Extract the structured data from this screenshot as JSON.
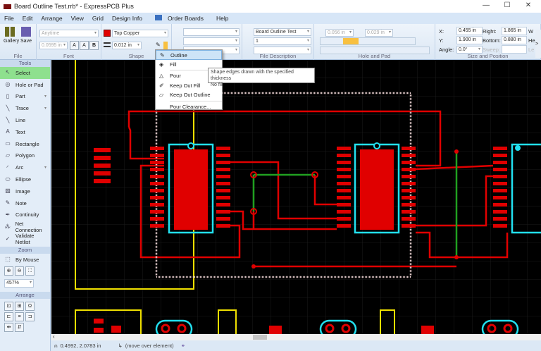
{
  "window": {
    "title": "Board Outline Test.rrb* - ExpressPCB Plus",
    "minimize": "—",
    "maximize": "☐",
    "close": "✕"
  },
  "menu": [
    "File",
    "Edit",
    "Arrange",
    "View",
    "Grid",
    "Design Info",
    "Order Boards",
    "Help"
  ],
  "ribbon": {
    "file": {
      "label": "File",
      "gallery": "Gallery",
      "save": "Save"
    },
    "font": {
      "label": "Font",
      "font_name": "Anytime",
      "font_size": "0.0595 in",
      "grow": "A",
      "shrink": "A",
      "bold": "B"
    },
    "shape": {
      "label": "Shape",
      "layer": "Top Copper",
      "layer_color": "#e00000",
      "thickness": "0.012 in"
    },
    "file_description": {
      "label": "File Description",
      "title": "Board Outline Test",
      "number": "1",
      "comment": ""
    },
    "hole_and_pad": {
      "label": "Hole and Pad",
      "pad_size": "0.056 in",
      "hole_size": "0.029 in"
    },
    "size_and_position": {
      "label": "Size and Position",
      "x_label": "X:",
      "x": "0.455 in",
      "y_label": "Y:",
      "y": "1.900 in",
      "angle_label": "Angle:",
      "angle": "0.0°",
      "right_label": "Right:",
      "right": "1.865 in",
      "bottom_label": "Bottom:",
      "bottom": "0.880 in",
      "sweep_label": "Sweep:",
      "w_label": "W",
      "h_label": "He",
      "l_label": "Le",
      "more": ">"
    }
  },
  "sidebar": {
    "tools_label": "Tools",
    "tools": [
      {
        "label": "Select",
        "icon": "↖",
        "selected": true
      },
      {
        "label": "Hole or Pad",
        "icon": "◎"
      },
      {
        "label": "Part",
        "icon": "▯",
        "arrow": "▾"
      },
      {
        "label": "Trace",
        "icon": "╲",
        "arrow": "▾"
      },
      {
        "label": "Line",
        "icon": "╲"
      },
      {
        "label": "Text",
        "icon": "A"
      },
      {
        "label": "Rectangle",
        "icon": "▭"
      },
      {
        "label": "Polygon",
        "icon": "▱"
      },
      {
        "label": "Arc",
        "icon": "◜",
        "arrow": "▾"
      },
      {
        "label": "Ellipse",
        "icon": "⬭"
      },
      {
        "label": "Image",
        "icon": "▨"
      },
      {
        "label": "Note",
        "icon": "✎"
      },
      {
        "label": "Continuity",
        "icon": "✒"
      },
      {
        "label": "Net Connection",
        "icon": "⁂"
      },
      {
        "label": "Validate Netlist",
        "icon": "✓"
      }
    ],
    "zoom_label": "Zoom",
    "by_mouse": "By Mouse",
    "zoom_level": "457%",
    "arrange_label": "Arrange"
  },
  "shape_menu": {
    "items": [
      {
        "label": "Outline",
        "icon": "✎",
        "highlighted": true
      },
      {
        "label": "Fill",
        "icon": "◈"
      },
      {
        "label": "Pour",
        "icon": "△"
      },
      {
        "label": "Keep Out Fill",
        "icon": "✐"
      },
      {
        "label": "Keep Out Outline",
        "icon": "▱"
      },
      {
        "label": "Pour Clearance...",
        "icon": ""
      }
    ],
    "tooltip_line1": "Shape edges drawn with the specified thickness",
    "tooltip_line2": "No fill"
  },
  "status": {
    "coords": "0.4992, 2.0783 in",
    "hint": "(move over element)"
  },
  "colors": {
    "copper": "#e00000",
    "silkscreen": "#22e0f0",
    "outline": "#e8e8e8",
    "trace_green": "#20a020",
    "board_edge": "#f0e000"
  }
}
